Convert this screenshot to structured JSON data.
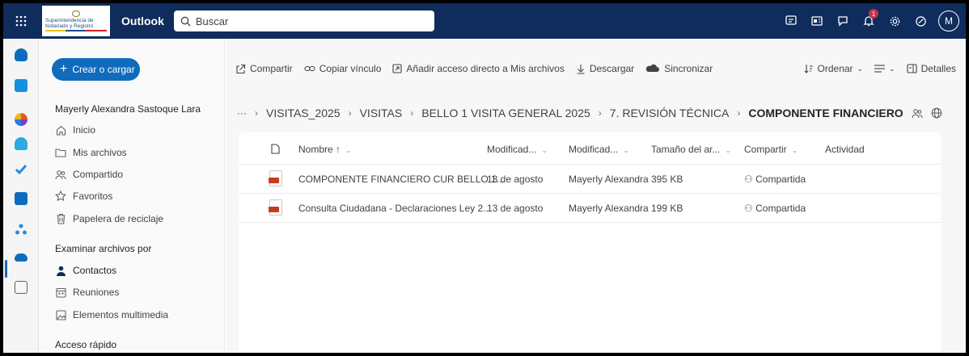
{
  "topbar": {
    "logo_text": "Superintendencia de Notariado y Registro",
    "app_name": "Outlook",
    "search_placeholder": "Buscar",
    "notification_count": "1",
    "avatar_initial": "M",
    "icons": [
      "waffle-icon",
      "teams-icon",
      "word-icon",
      "feedback-icon",
      "bell-icon",
      "gear-icon",
      "copilot-icon"
    ],
    "bar_color": "#0f2c5c"
  },
  "sidebar": {
    "create_label": "Crear o cargar",
    "user_name": "Mayerly Alexandra Sastoque Lara",
    "nav": [
      {
        "label": "Inicio",
        "icon": "home-icon"
      },
      {
        "label": "Mis archivos",
        "icon": "folder-icon"
      },
      {
        "label": "Compartido",
        "icon": "people-icon"
      },
      {
        "label": "Favoritos",
        "icon": "star-icon"
      },
      {
        "label": "Papelera de reciclaje",
        "icon": "trash-icon"
      }
    ],
    "browse_heading": "Examinar archivos por",
    "browse": [
      {
        "label": "Contactos",
        "icon": "person-icon"
      },
      {
        "label": "Reuniones",
        "icon": "calendar-icon"
      },
      {
        "label": "Elementos multimedia",
        "icon": "image-icon"
      }
    ],
    "quick_access_heading": "Acceso rápido"
  },
  "commands": {
    "share": "Compartir",
    "copy_link": "Copiar vínculo",
    "add_shortcut": "Añadir acceso directo a Mis archivos",
    "download": "Descargar",
    "sync": "Sincronizar",
    "sort": "Ordenar",
    "details": "Detalles"
  },
  "breadcrumb": {
    "ellipsis": "···",
    "items": [
      "VISITAS_2025",
      "VISITAS",
      "BELLO 1 VISITA GENERAL 2025",
      "7. REVISIÓN TÉCNICA"
    ],
    "current": "COMPONENTE FINANCIERO"
  },
  "table": {
    "headers": {
      "name": "Nombre ↑",
      "modified": "Modificad...",
      "modified_by": "Modificad...",
      "size": "Tamaño del ar...",
      "sharing": "Compartir",
      "activity": "Actividad"
    },
    "rows": [
      {
        "name": "COMPONENTE FINANCIERO CUR BELLO 1...",
        "modified": "13 de agosto",
        "modified_by": "Mayerly Alexandra",
        "size": "395 KB",
        "sharing": "Compartida",
        "type": "ppt-icon"
      },
      {
        "name": "Consulta Ciudadana - Declaraciones Ley 2...",
        "modified": "13 de agosto",
        "modified_by": "Mayerly Alexandra",
        "size": "199 KB",
        "sharing": "Compartida",
        "type": "ppt-icon"
      }
    ]
  },
  "colors": {
    "accent": "#0f6cbd",
    "file_red": "#c43e1c",
    "badge": "#c4314b"
  }
}
